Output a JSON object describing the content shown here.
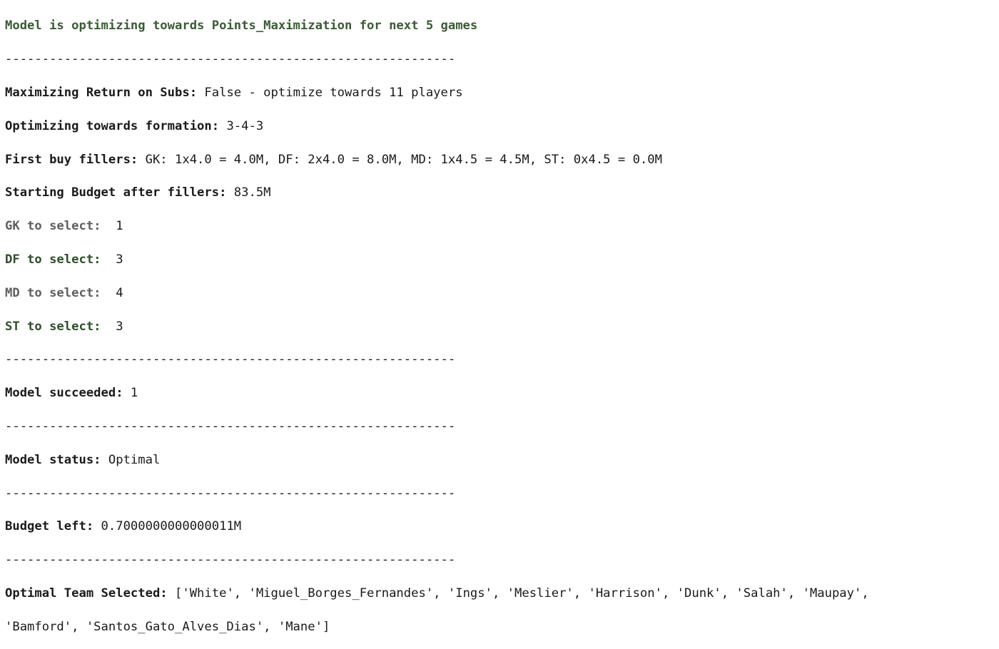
{
  "header": "Model is optimizing towards Points_Maximization for next 5 games",
  "separator": "-------------------------------------------------------------",
  "maximizing": {
    "label": "Maximizing Return on Subs:",
    "value": " False - optimize towards 11 players"
  },
  "formation": {
    "label": "Optimizing towards formation:",
    "value": " 3-4-3"
  },
  "fillers": {
    "label": "First buy fillers:",
    "value": " GK: 1x4.0 = 4.0M, DF: 2x4.0 = 8.0M, MD: 1x4.5 = 4.5M, ST: 0x4.5 = 0.0M"
  },
  "budget_start": {
    "label": "Starting Budget after fillers:",
    "value": " 83.5M"
  },
  "select": [
    {
      "label": "GK to select:",
      "value": "  1"
    },
    {
      "label": "DF to select:",
      "value": "  3"
    },
    {
      "label": "MD to select:",
      "value": "  4"
    },
    {
      "label": "ST to select:",
      "value": "  3"
    }
  ],
  "succeeded": {
    "label": "Model succeeded:",
    "value": " 1"
  },
  "status": {
    "label": "Model status:",
    "value": " Optimal"
  },
  "budget_left": {
    "label": "Budget left:",
    "value": " 0.7000000000000011M"
  },
  "team": {
    "label": "Optimal Team Selected:",
    "value_line1": " ['White', 'Miguel_Borges_Fernandes', 'Ings', 'Meslier', 'Harrison', 'Dunk', 'Salah', 'Maupay',",
    "value_line2": "'Bamford', 'Santos_Gato_Alves_Dias', 'Mane']"
  }
}
